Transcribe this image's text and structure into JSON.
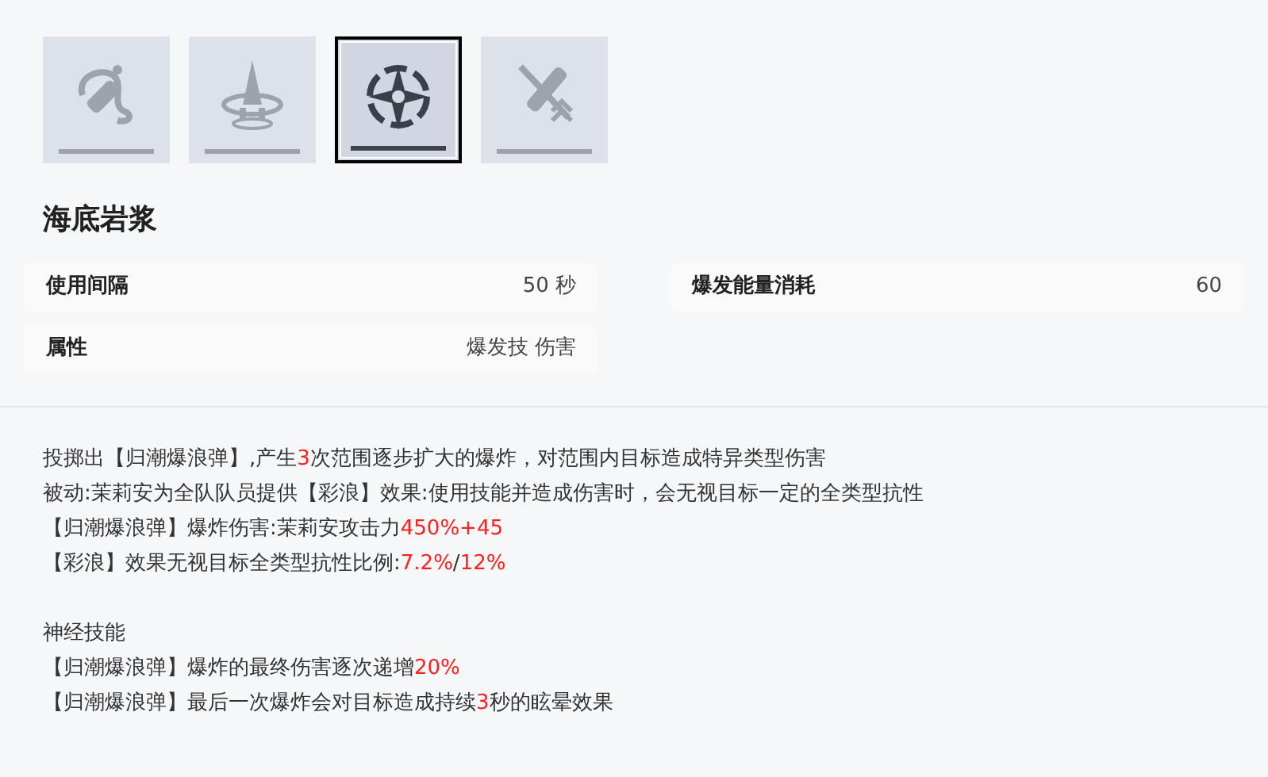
{
  "skills": [
    {
      "kind": "grenade",
      "selected": false
    },
    {
      "kind": "spire",
      "selected": false
    },
    {
      "kind": "burst",
      "selected": true
    },
    {
      "kind": "crossed",
      "selected": false
    }
  ],
  "title": "海底岩浆",
  "stats": [
    {
      "label": "使用间隔",
      "value": "50 秒"
    },
    {
      "label": "爆发能量消耗",
      "value": "60"
    },
    {
      "label": "属性",
      "value": "爆发技 伤害"
    }
  ],
  "description": [
    [
      {
        "text": "投掷出【归潮爆浪弹】,产生",
        "highlight": false
      },
      {
        "text": "3",
        "highlight": true
      },
      {
        "text": "次范围逐步扩大的爆炸，对范围内目标造成特异类型伤害",
        "highlight": false
      }
    ],
    [
      {
        "text": "被动:茉莉安为全队队员提供【彩浪】效果:使用技能并造成伤害时，会无视目标一定的全类型抗性",
        "highlight": false
      }
    ],
    [
      {
        "text": "【归潮爆浪弹】爆炸伤害:茉莉安攻击力",
        "highlight": false
      },
      {
        "text": "450%+45",
        "highlight": true
      }
    ],
    [
      {
        "text": "【彩浪】效果无视目标全类型抗性比例:",
        "highlight": false
      },
      {
        "text": "7.2%",
        "highlight": true
      },
      {
        "text": "/",
        "highlight": false
      },
      {
        "text": "12%",
        "highlight": true
      }
    ]
  ],
  "neural": {
    "heading": "神经技能",
    "lines": [
      [
        {
          "text": "【归潮爆浪弹】爆炸的最终伤害逐次递增",
          "highlight": false
        },
        {
          "text": "20%",
          "highlight": true
        }
      ],
      [
        {
          "text": "【归潮爆浪弹】最后一次爆炸会对目标造成持续",
          "highlight": false
        },
        {
          "text": "3",
          "highlight": true
        },
        {
          "text": "秒的眩晕效果",
          "highlight": false
        }
      ]
    ]
  }
}
